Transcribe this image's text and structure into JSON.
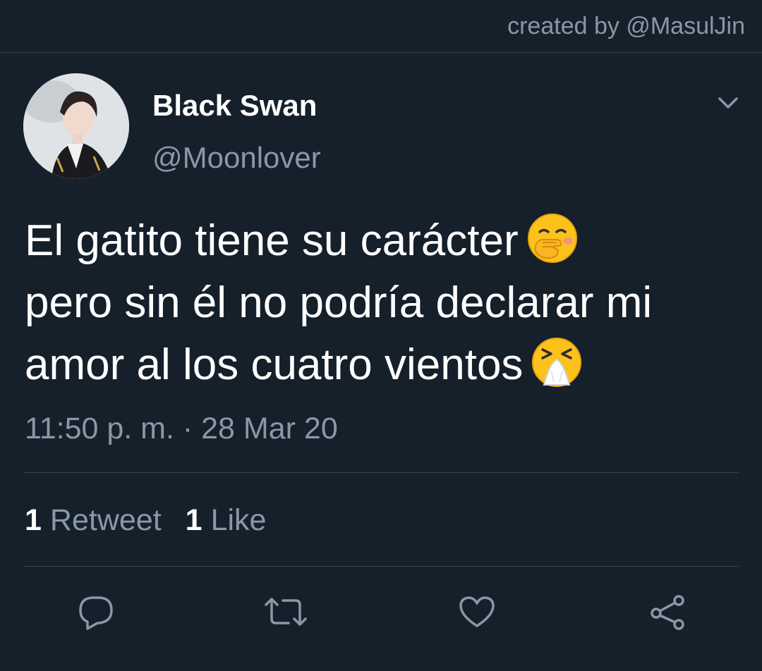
{
  "credit": "created by @MasulJin",
  "tweet": {
    "display_name": "Black Swan",
    "handle": "@Moonlover",
    "text_lines": [
      "El gatito tiene su carácter",
      "pero sin él no podría declarar mi",
      "amor al los cuatro vientos"
    ],
    "emojis": [
      "hand-over-mouth-emoji",
      "sneezing-face-emoji"
    ],
    "timestamp": "11:50 p. m. · 28 Mar 20",
    "stats": {
      "retweets_count": "1",
      "retweets_label": "Retweet",
      "likes_count": "1",
      "likes_label": "Like"
    }
  },
  "icons": {
    "menu": "chevron-down-icon",
    "reply": "reply-icon",
    "retweet": "retweet-icon",
    "like": "heart-icon",
    "share": "share-icon"
  },
  "colors": {
    "background": "#15202b",
    "secondary_text": "#8899a6",
    "divider": "#38444d",
    "primary_text": "#ffffff"
  }
}
